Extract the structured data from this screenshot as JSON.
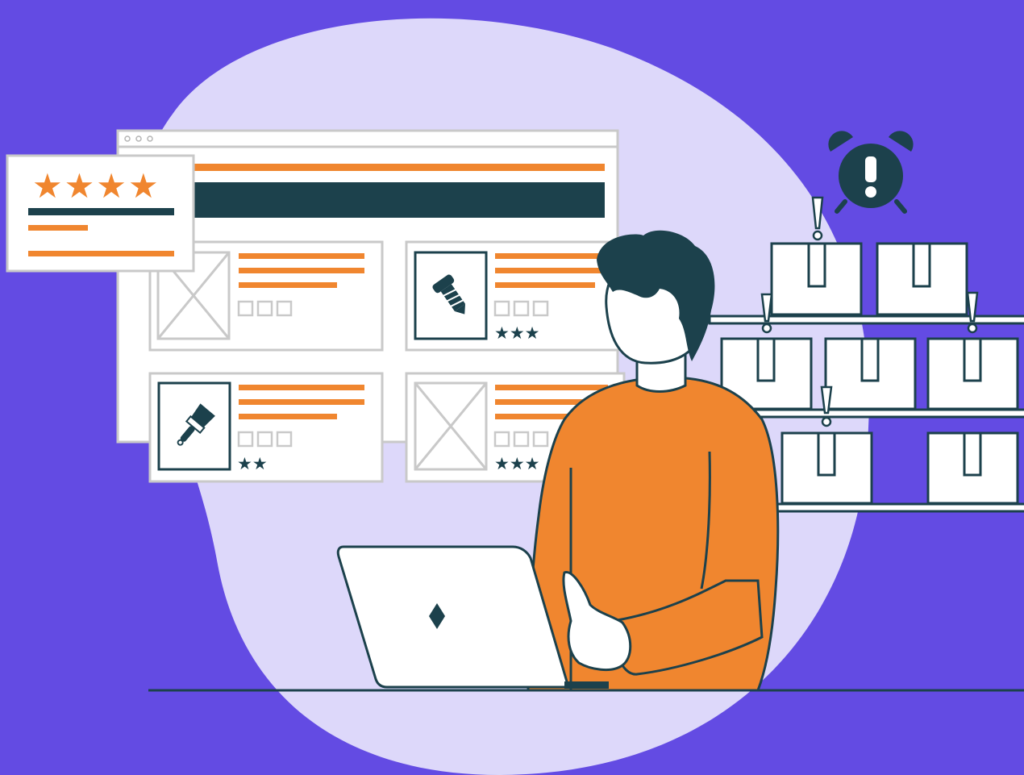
{
  "illustration": {
    "rating_card": {
      "stars": "★★★★",
      "rating": 4
    },
    "products": [
      {
        "icon": "placeholder-image-icon",
        "stars": ""
      },
      {
        "icon": "screw-icon",
        "stars": "★★★"
      },
      {
        "icon": "paintbrush-icon",
        "stars": "★★"
      },
      {
        "icon": "placeholder-image-icon",
        "stars": "★★★"
      }
    ],
    "alarm": {
      "icon": "alarm-clock-icon",
      "mark": "!"
    },
    "shelf": {
      "boxes": 7,
      "flagged_boxes": 4
    }
  },
  "colors": {
    "background": "#634be3",
    "blob": "#ddd8fa",
    "orange": "#f0862f",
    "navy": "#1c414c",
    "panel": "#ffffff",
    "outline": "#c9c9c9"
  }
}
